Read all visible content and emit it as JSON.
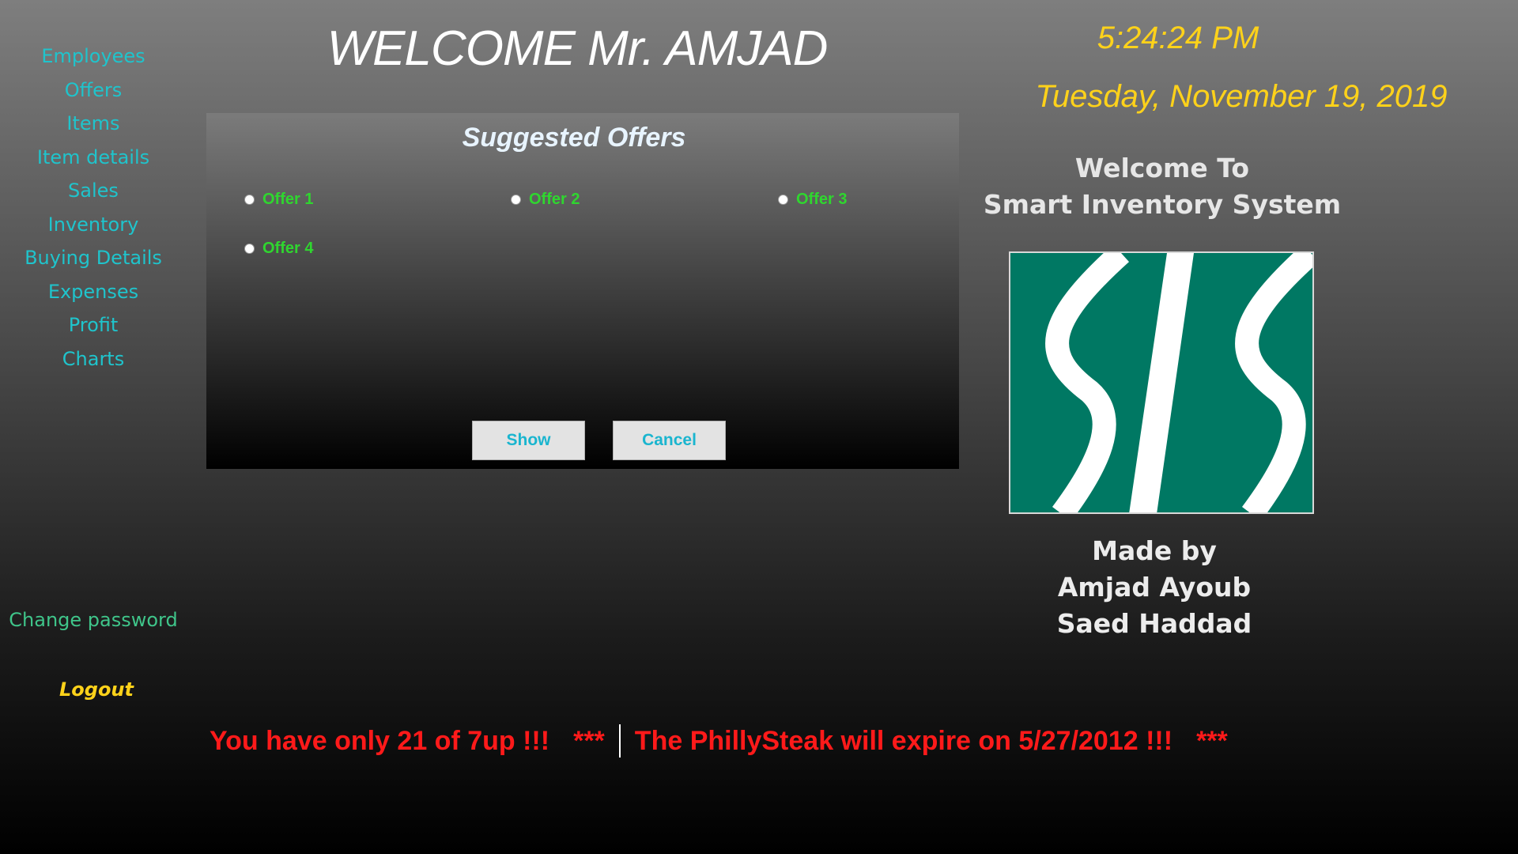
{
  "nav": {
    "items": [
      {
        "label": "Employees"
      },
      {
        "label": "Offers"
      },
      {
        "label": "Items"
      },
      {
        "label": "Item details"
      },
      {
        "label": "Sales"
      },
      {
        "label": "Inventory"
      },
      {
        "label": "Buying Details"
      },
      {
        "label": "Expenses"
      },
      {
        "label": "Profit"
      },
      {
        "label": "Charts"
      }
    ],
    "change_password": "Change password",
    "logout": "Logout"
  },
  "header": {
    "welcome": "WELCOME Mr. AMJAD",
    "time": "5:24:24 PM",
    "date": "Tuesday, November 19, 2019"
  },
  "info": {
    "welcome_line1": "Welcome To",
    "welcome_line2": "Smart Inventory System",
    "made_by": "Made by",
    "author1": "Amjad Ayoub",
    "author2": "Saed Haddad"
  },
  "panel": {
    "title": "Suggested Offers",
    "options": [
      {
        "label": "Offer 1"
      },
      {
        "label": "Offer 2"
      },
      {
        "label": "Offer 3"
      },
      {
        "label": "Offer 4"
      }
    ],
    "show_label": "Show",
    "cancel_label": "Cancel"
  },
  "ticker": {
    "msg1": "You have only 21 of 7up !!!",
    "stars1": "***",
    "msg2": "The PhillySteak will expire on 5/27/2012 !!!",
    "stars2": "***"
  },
  "colors": {
    "nav_text": "#1fc4cc",
    "change_password": "#3fc58a",
    "accent_yellow": "#ffd21a",
    "offer_green": "#2fd62f",
    "logo_green": "#007863",
    "ticker_red": "#ff1a1a"
  }
}
